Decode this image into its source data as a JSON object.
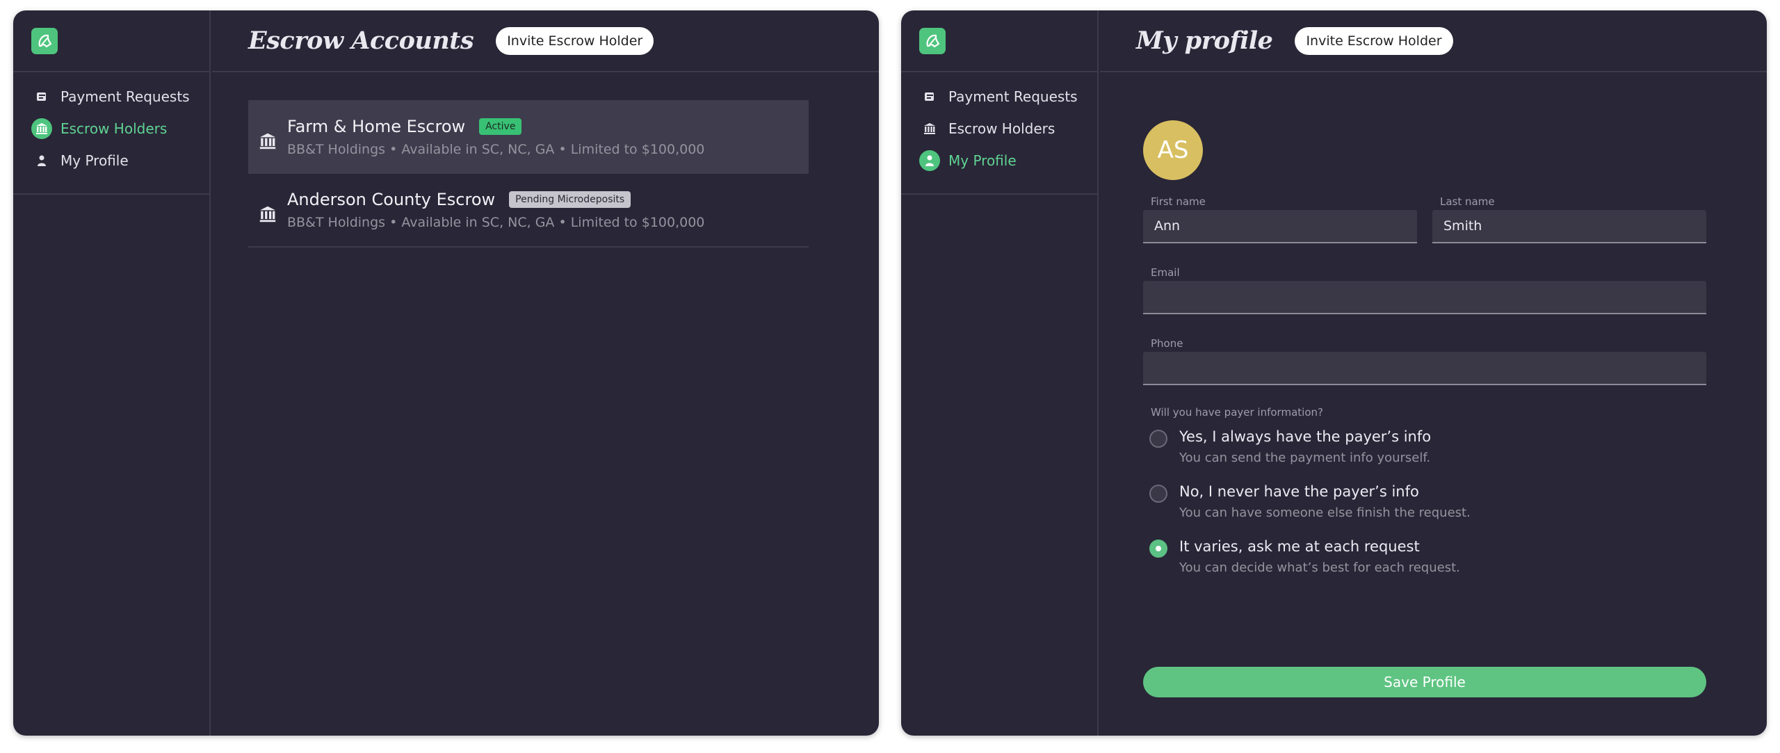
{
  "colors": {
    "panel_bg": "#292637",
    "accent_green": "#4ec47e",
    "avatar_bg": "#d8bf61",
    "badge_active": "#38c175",
    "badge_pending": "#c6c4cc"
  },
  "left": {
    "nav": {
      "items": [
        {
          "label": "Payment Requests",
          "icon": "payment-requests-icon"
        },
        {
          "label": "Escrow Holders",
          "icon": "bank-icon",
          "active": true
        },
        {
          "label": "My Profile",
          "icon": "person-icon"
        }
      ]
    },
    "header": {
      "title": "Escrow Accounts",
      "invite_label": "Invite Escrow Holder"
    },
    "accounts": [
      {
        "name": "Farm & Home Escrow",
        "badge": "Active",
        "details": "BB&T Holdings • Available in SC, NC, GA • Limited to $100,000"
      },
      {
        "name": "Anderson County Escrow",
        "badge": "Pending Microdeposits",
        "details": "BB&T Holdings • Available in SC, NC, GA • Limited to $100,000"
      }
    ]
  },
  "right": {
    "nav": {
      "items": [
        {
          "label": "Payment Requests",
          "icon": "payment-requests-icon"
        },
        {
          "label": "Escrow Holders",
          "icon": "bank-icon"
        },
        {
          "label": "My Profile",
          "icon": "person-icon",
          "active": true
        }
      ]
    },
    "header": {
      "title": "My profile",
      "invite_label": "Invite Escrow Holder"
    },
    "profile": {
      "avatar_initials": "AS",
      "first_name": {
        "label": "First name",
        "value": "Ann"
      },
      "last_name": {
        "label": "Last name",
        "value": "Smith"
      },
      "email": {
        "label": "Email",
        "value": ""
      },
      "phone": {
        "label": "Phone",
        "value": ""
      },
      "payer_question": "Will you have payer information?",
      "options": [
        {
          "title": "Yes, I always have the payer’s info",
          "subtitle": "You can send the payment info yourself.",
          "checked": false
        },
        {
          "title": "No, I never have the payer’s info",
          "subtitle": "You can have someone else finish the request.",
          "checked": false
        },
        {
          "title": "It varies, ask me at each request",
          "subtitle": "You can decide what’s best for each request.",
          "checked": true
        }
      ],
      "save_label": "Save Profile"
    }
  }
}
